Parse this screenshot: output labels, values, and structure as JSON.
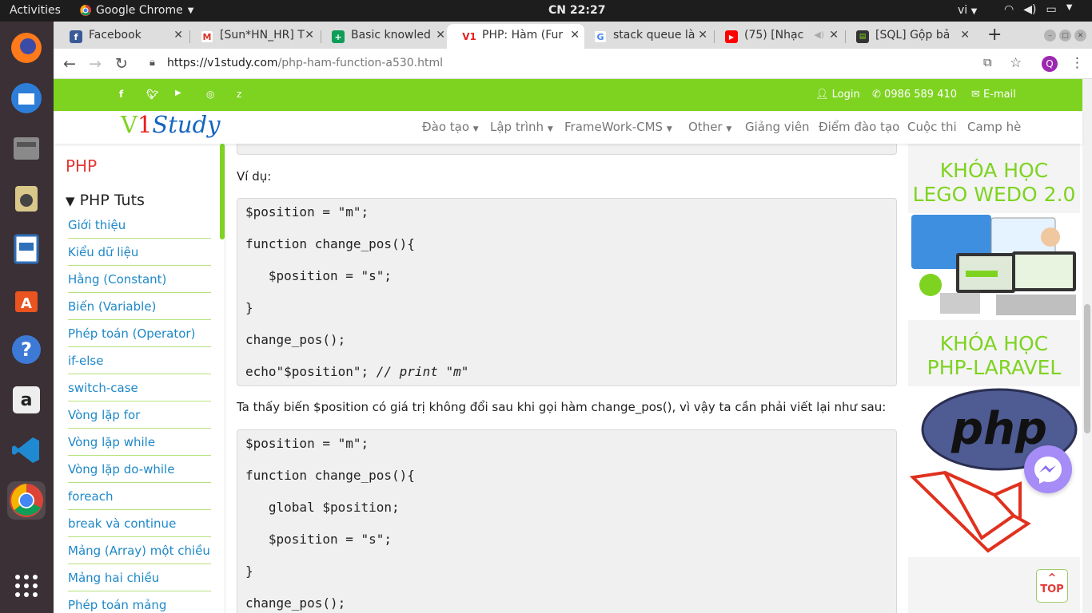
{
  "topbar": {
    "activities": "Activities",
    "app_name": "Google Chrome",
    "clock": "CN 22:27",
    "lang": "vi"
  },
  "browser": {
    "tabs": [
      {
        "label": "Facebook",
        "favicon": "facebook-icon"
      },
      {
        "label": "[Sun*HN_HR] T",
        "favicon": "gmail-icon"
      },
      {
        "label": "Basic knowled",
        "favicon": "sheets-icon"
      },
      {
        "label": "PHP: Hàm (Fur",
        "favicon": "v1-icon"
      },
      {
        "label": "stack queue là",
        "favicon": "google-icon"
      },
      {
        "label": "(75) [Nhạc",
        "favicon": "youtube-icon"
      },
      {
        "label": "[SQL] Gộp bả",
        "favicon": "terminal-icon"
      }
    ],
    "url_host": "https://v1study.com",
    "url_path": "/php-ham-function-a530.html",
    "avatar_letter": "Q"
  },
  "site": {
    "social": [
      "f",
      "t",
      "yt",
      "ig",
      "z"
    ],
    "login": "Login",
    "phone": "0986 589 410",
    "email": "E-mail",
    "logo_v": "V",
    "logo_one": "1",
    "logo_rest": "Study",
    "menu": [
      "Đào tạo",
      "Lập trình",
      "FrameWork-CMS",
      "Other",
      "Giảng viên",
      "Điểm đào tạo",
      "Cuộc thi",
      "Camp hè"
    ],
    "accent": "#7ed321"
  },
  "sidebar": {
    "title": "PHP",
    "subtitle": "PHP Tuts",
    "links": [
      "Giới thiệu",
      "Kiểu dữ liệu",
      "Hằng (Constant)",
      "Biến (Variable)",
      "Phép toán (Operator)",
      "if-else",
      "switch-case",
      "Vòng lặp for",
      "Vòng lặp while",
      "Vòng lặp do-while",
      "foreach",
      "break và continue",
      "Mảng (Array) một chiều",
      "Mảng hai chiều",
      "Phép toán mảng"
    ]
  },
  "content": {
    "example_label": "Ví dụ:",
    "code1": [
      "$position = \"m\";",
      "function change_pos(){",
      "   $position = \"s\";",
      "}",
      "change_pos();",
      "echo\"$position\"; "
    ],
    "code1_comment": "// print \"m\"",
    "explain": "Ta thấy biến $position có giá trị không đổi sau khi gọi hàm change_pos(), vì vậy ta cần phải viết lại như sau:",
    "code2": [
      "$position = \"m\";",
      "function change_pos(){",
      "   global $position;",
      "   $position = \"s\";",
      "}",
      "change_pos();"
    ]
  },
  "ads": {
    "lego_title_1": "KHÓA HỌC",
    "lego_title_2": "LEGO WEDO 2.0",
    "php_title_1": "KHÓA HỌC",
    "php_title_2": "PHP-LARAVEL",
    "php_logo_text": "php"
  },
  "top_button": {
    "arrow": "^",
    "label": "TOP"
  }
}
